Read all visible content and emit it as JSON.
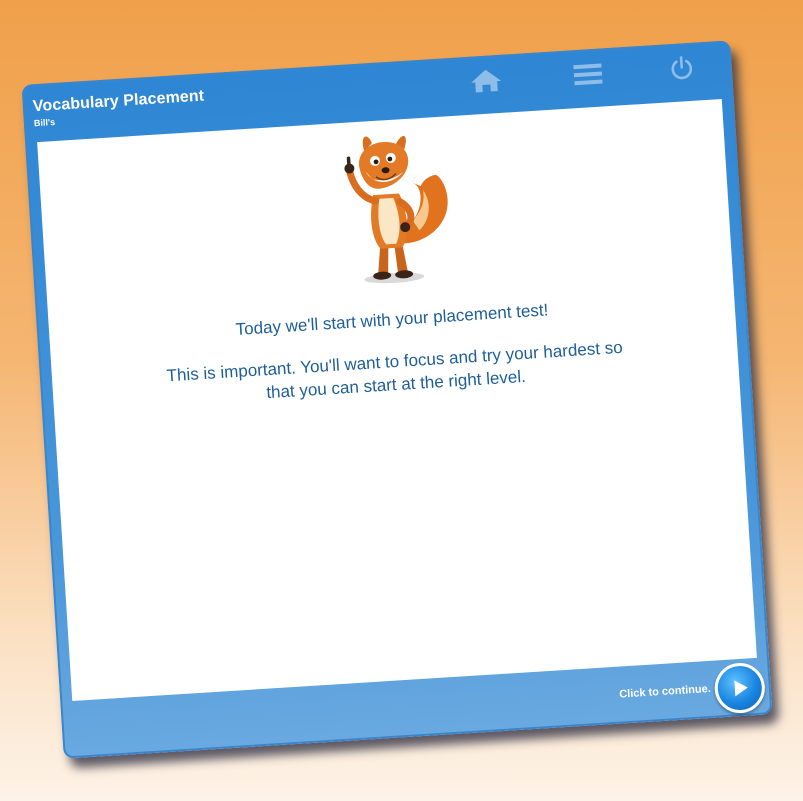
{
  "header": {
    "title": "Vocabulary Placement",
    "subtitle": "Bill's"
  },
  "icons": {
    "home": "home-icon",
    "menu": "menu-icon",
    "power": "power-icon"
  },
  "colors": {
    "frame_blue": "#2e86d4",
    "text_blue": "#1d5e9a",
    "icon_blue": "#7fb6e6",
    "button_blue": "#1a85e0"
  },
  "content": {
    "line1": "Today we'll start with your placement test!",
    "line2": "This is important. You'll want to focus and try your hardest so that you can start at the right level."
  },
  "footer": {
    "continue_label": "Click to continue."
  }
}
